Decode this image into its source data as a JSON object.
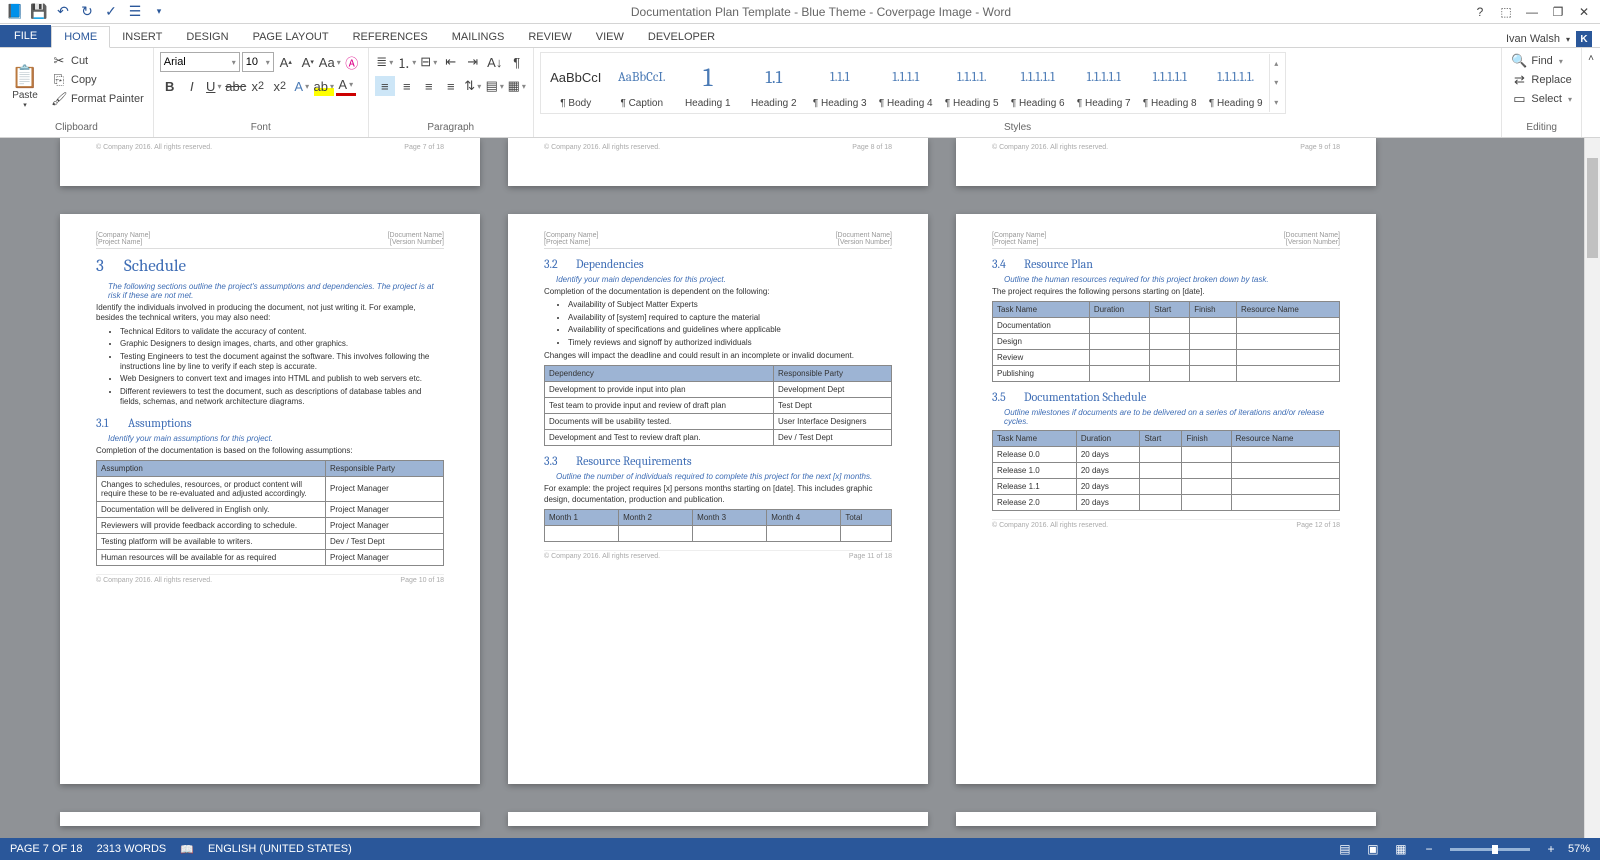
{
  "title": "Documentation Plan Template - Blue Theme - Coverpage Image - Word",
  "user_name": "Ivan Walsh",
  "user_initial": "K",
  "tabs": [
    "FILE",
    "HOME",
    "INSERT",
    "DESIGN",
    "PAGE LAYOUT",
    "REFERENCES",
    "MAILINGS",
    "REVIEW",
    "VIEW",
    "DEVELOPER"
  ],
  "active_tab": "HOME",
  "clipboard": {
    "paste": "Paste",
    "cut": "Cut",
    "copy": "Copy",
    "format_painter": "Format Painter",
    "label": "Clipboard"
  },
  "font": {
    "name": "Arial",
    "size": "10",
    "label": "Font"
  },
  "paragraph": {
    "label": "Paragraph"
  },
  "styles": {
    "label": "Styles",
    "items": [
      {
        "prev": "AaBbCcI",
        "name": "¶ Body"
      },
      {
        "prev": "AaBbCcI.",
        "name": "¶ Caption"
      },
      {
        "prev": "1",
        "name": "Heading 1"
      },
      {
        "prev": "1.1",
        "name": "Heading 2"
      },
      {
        "prev": "1.1.1",
        "name": "¶ Heading 3"
      },
      {
        "prev": "1.1.1.1",
        "name": "¶ Heading 4"
      },
      {
        "prev": "1.1.1.1.",
        "name": "¶ Heading 5"
      },
      {
        "prev": "1.1.1.1.1",
        "name": "¶ Heading 6"
      },
      {
        "prev": "1.1.1.1.1",
        "name": "¶ Heading 7"
      },
      {
        "prev": "1.1.1.1.1",
        "name": "¶ Heading 8"
      },
      {
        "prev": "1.1.1.1.1.",
        "name": "¶ Heading 9"
      }
    ]
  },
  "editing": {
    "find": "Find",
    "replace": "Replace",
    "select": "Select",
    "label": "Editing"
  },
  "stub_footer": {
    "copyright": "© Company 2016. All rights reserved.",
    "p7": "Page 7 of 18",
    "p8": "Page 8 of 18",
    "p9": "Page 9 of 18"
  },
  "page_header": {
    "company": "[Company Name]",
    "project": "[Project Name]",
    "docname": "[Document Name]",
    "version": "[Version Number]"
  },
  "page1": {
    "h1_num": "3",
    "h1": "Schedule",
    "ital1": "The following sections outline the project's assumptions and dependencies. The project is at risk if these are not met.",
    "p1": "Identify the individuals involved in producing the document, not just writing it. For example, besides the technical writers, you may also need:",
    "b1": "Technical Editors to validate the accuracy of content.",
    "b2": "Graphic Designers to design images, charts, and other graphics.",
    "b3": "Testing Engineers to test the document against the software. This involves following the instructions line by line to verify if each step is accurate.",
    "b4": "Web Designers to convert text and images into HTML and publish to web servers etc.",
    "b5": "Different reviewers to test the document, such as descriptions of database tables and fields, schemas, and network architecture diagrams.",
    "h2_num": "3.1",
    "h2": "Assumptions",
    "ital2": "Identify your main assumptions for this project.",
    "p2": "Completion of the documentation is based on the following assumptions:",
    "th1": "Assumption",
    "th2": "Responsible Party",
    "rows": [
      [
        "Changes to schedules, resources, or product content will require these to be re-evaluated and adjusted accordingly.",
        "Project Manager"
      ],
      [
        "Documentation will be delivered in English only.",
        "Project Manager"
      ],
      [
        "Reviewers will provide feedback according to schedule.",
        "Project Manager"
      ],
      [
        "Testing platform will be available to writers.",
        "Dev / Test Dept"
      ],
      [
        "Human resources will be available for as required",
        "Project Manager"
      ]
    ],
    "foot_l": "© Company 2016. All rights reserved.",
    "foot_r": "Page 10 of 18"
  },
  "page2": {
    "h2a_num": "3.2",
    "h2a": "Dependencies",
    "ital1": "Identify your main dependencies for this project.",
    "p1": "Completion of the documentation is dependent on the following:",
    "b1": "Availability of Subject Matter Experts",
    "b2": "Availability of [system] required to capture the material",
    "b3": "Availability of specifications and guidelines where applicable",
    "b4": "Timely reviews and signoff by authorized individuals",
    "p2": "Changes will impact the deadline and could result in an incomplete or invalid document.",
    "th1": "Dependency",
    "th2": "Responsible Party",
    "rowsA": [
      [
        "Development to provide input into plan",
        "Development Dept"
      ],
      [
        "Test team to provide input and review of draft plan",
        "Test Dept"
      ],
      [
        "Documents will be usability tested.",
        "User Interface Designers"
      ],
      [
        "Development and Test to review draft plan.",
        "Dev / Test Dept"
      ]
    ],
    "h2b_num": "3.3",
    "h2b": "Resource Requirements",
    "ital2": "Outline the number of individuals required to complete this project for the next [x] months.",
    "p3": "For example: the project requires [x] persons months starting on [date]. This includes graphic design, documentation, production and publication.",
    "m": [
      "Month 1",
      "Month 2",
      "Month 3",
      "Month 4",
      "Total"
    ],
    "foot_l": "© Company 2016. All rights reserved.",
    "foot_r": "Page 11 of 18"
  },
  "page3": {
    "h2a_num": "3.4",
    "h2a": "Resource Plan",
    "ital1": "Outline the human resources required for this project broken down by task.",
    "p1": "The project requires the following persons starting on [date].",
    "thA": [
      "Task Name",
      "Duration",
      "Start",
      "Finish",
      "Resource Name"
    ],
    "rowsA": [
      [
        "Documentation",
        "",
        "",
        "",
        ""
      ],
      [
        "Design",
        "",
        "",
        "",
        ""
      ],
      [
        "Review",
        "",
        "",
        "",
        ""
      ],
      [
        "Publishing",
        "",
        "",
        "",
        ""
      ]
    ],
    "h2b_num": "3.5",
    "h2b": "Documentation Schedule",
    "ital2": "Outline milestones if documents are to be delivered on a series of iterations and/or release cycles.",
    "thB": [
      "Task Name",
      "Duration",
      "Start",
      "Finish",
      "Resource Name"
    ],
    "rowsB": [
      [
        "Release 0.0",
        "20 days",
        "",
        "",
        ""
      ],
      [
        "Release 1.0",
        "20 days",
        "",
        "",
        ""
      ],
      [
        "Release 1.1",
        "20 days",
        "",
        "",
        ""
      ],
      [
        "Release 2.0",
        "20 days",
        "",
        "",
        ""
      ]
    ],
    "foot_l": "© Company 2016. All rights reserved.",
    "foot_r": "Page 12 of 18"
  },
  "status": {
    "page": "PAGE 7 OF 18",
    "words": "2313 WORDS",
    "lang": "ENGLISH (UNITED STATES)",
    "zoom": "57%"
  }
}
